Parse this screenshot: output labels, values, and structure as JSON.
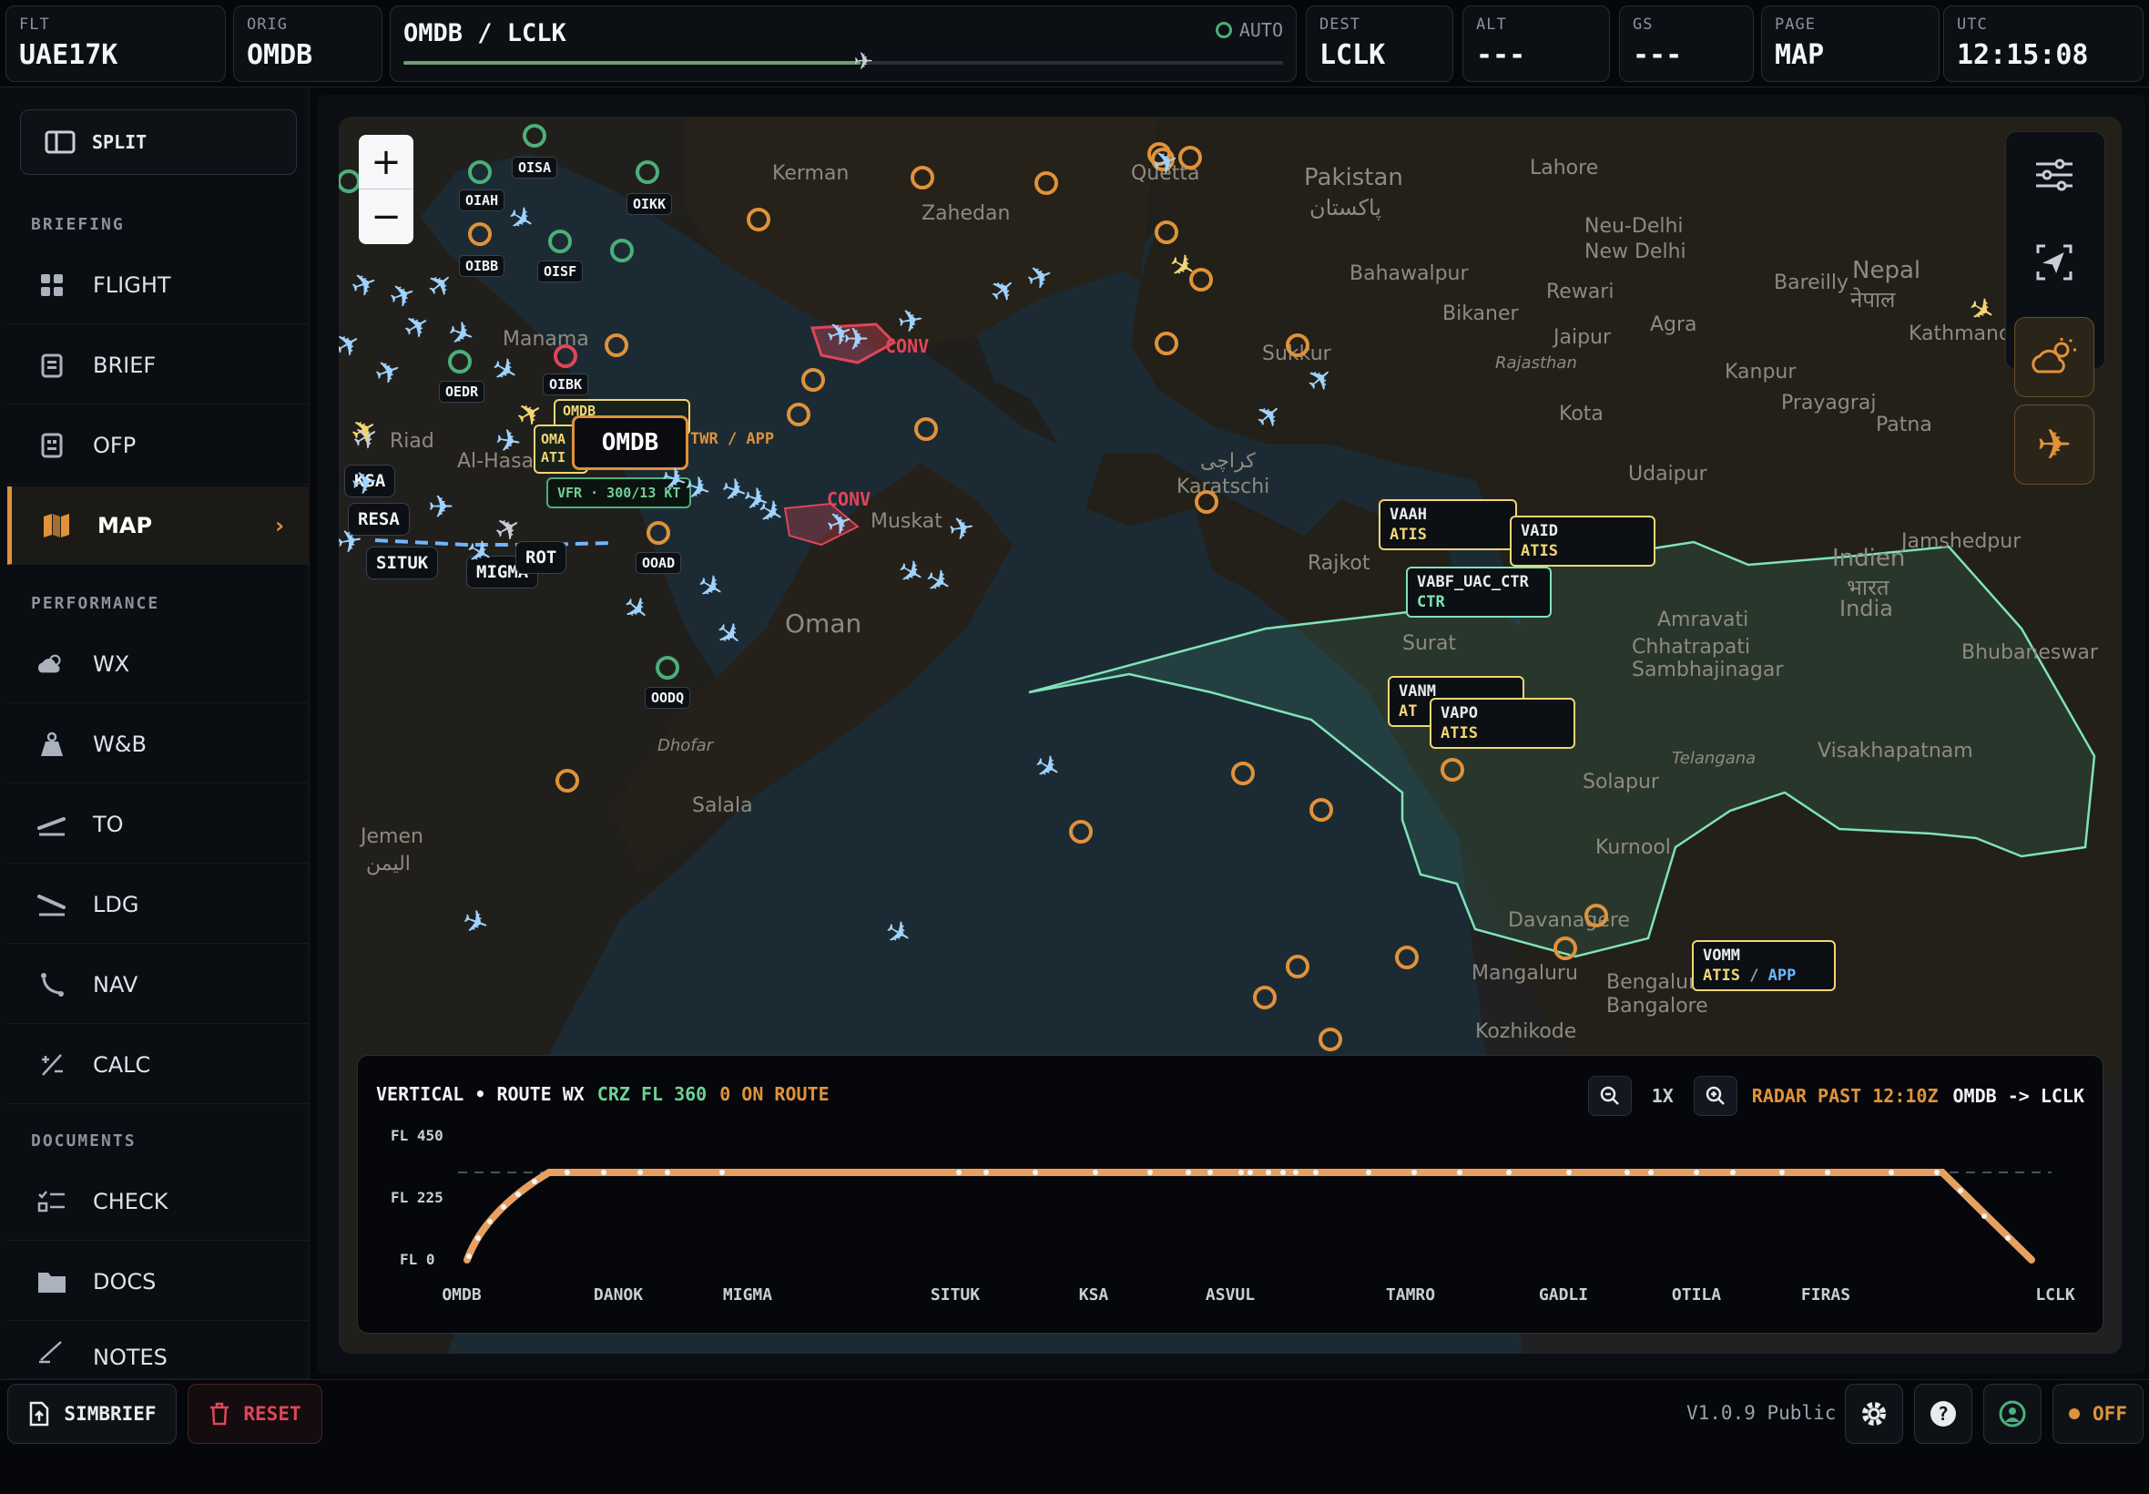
{
  "topbar": {
    "flt": {
      "label": "FLT",
      "value": "UAE17K"
    },
    "orig": {
      "label": "ORIG",
      "value": "OMDB"
    },
    "route": {
      "value": "OMDB / LCLK",
      "auto": "AUTO",
      "progress": 0.52
    },
    "dest": {
      "label": "DEST",
      "value": "LCLK"
    },
    "alt": {
      "label": "ALT",
      "value": "---"
    },
    "gs": {
      "label": "GS",
      "value": "---"
    },
    "page": {
      "label": "PAGE",
      "value": "MAP"
    },
    "utc": {
      "label": "UTC",
      "value": "12:15:08"
    }
  },
  "sidebar": {
    "split_label": "SPLIT",
    "sections": {
      "briefing": "BRIEFING",
      "performance": "PERFORMANCE",
      "documents": "DOCUMENTS"
    },
    "items": [
      {
        "label": "FLIGHT",
        "icon": "grid-icon"
      },
      {
        "label": "BRIEF",
        "icon": "clipboard-icon"
      },
      {
        "label": "OFP",
        "icon": "document-icon"
      },
      {
        "label": "MAP",
        "icon": "map-icon",
        "active": true
      },
      {
        "label": "WX",
        "icon": "cloud-sun-icon"
      },
      {
        "label": "W&B",
        "icon": "weight-icon"
      },
      {
        "label": "TO",
        "icon": "takeoff-icon"
      },
      {
        "label": "LDG",
        "icon": "landing-icon"
      },
      {
        "label": "NAV",
        "icon": "route-icon"
      },
      {
        "label": "CALC",
        "icon": "calc-icon"
      },
      {
        "label": "CHECK",
        "icon": "checklist-icon"
      },
      {
        "label": "DOCS",
        "icon": "folder-icon"
      },
      {
        "label": "NOTES",
        "icon": "pen-icon"
      }
    ]
  },
  "bottombar": {
    "simbrief": "SIMBRIEF",
    "reset": "RESET",
    "version": "V1.0.9 Public",
    "off": "OFF"
  },
  "map": {
    "zoom_in": "+",
    "zoom_out": "−",
    "labels": {
      "place_names": [
        "Pakistan",
        "پاکستان",
        "Lahore",
        "Neu-Delhi",
        "New Delhi",
        "Bareilly",
        "Nepal",
        "नेपाल",
        "Bikaner",
        "Rajasthan",
        "Jaipur",
        "Agra",
        "Kanpur",
        "Prayagraj",
        "Patna",
        "Kota",
        "Udaipur",
        "Indien",
        "भारत",
        "India",
        "Rajkot",
        "Surat",
        "Amravati",
        "Chhatrapati Sambhajinagar",
        "Jamshedpur",
        "Bhubaneswar",
        "Visakhapatnam",
        "Telangana",
        "Solapur",
        "Kurnool",
        "Davanagere",
        "Bengaluru",
        "Bangalore",
        "Mangaluru",
        "Kozhikode",
        "Karatschi",
        "کراچی",
        "Sukkur",
        "Zahedan",
        "Kerman",
        "Quetta",
        "Muskat",
        "Salala",
        "Jemen",
        "اليمن",
        "Dhofar",
        "Al-Hasa",
        "Riad",
        "Manama",
        "Oman",
        "Kathmandu",
        "Bahawalpur",
        "Rewari"
      ],
      "conv1": "CONV",
      "conv2": "CONV"
    },
    "airports_green": [
      "OISA",
      "OIAH",
      "OIKK",
      "OISF",
      "OEDR",
      "OODQ"
    ],
    "airports_other": [
      "OIBB",
      "OIBK",
      "OOAD"
    ],
    "waypoints": [
      "SITUK",
      "MIGMA",
      "RESA",
      "KSA",
      "ROT"
    ],
    "omdb_popup": {
      "code": "OMDB",
      "sub": "OMDB",
      "stations": "TWR / APP",
      "vfr": "VFR · 300/13 KT",
      "atis": "OMA ATI"
    },
    "atc": [
      {
        "code": "VAAH",
        "svc": "ATIS"
      },
      {
        "code": "VAID",
        "svc": "ATIS"
      },
      {
        "code": "VABF_UAC_CTR",
        "svc": "CTR"
      },
      {
        "code": "VANM",
        "svc": "AT"
      },
      {
        "code": "VAPO",
        "svc": "ATIS"
      },
      {
        "code": "VOMM",
        "svc": "ATIS",
        "svc2": "APP"
      }
    ]
  },
  "profile": {
    "title": "VERTICAL • ROUTE WX",
    "crz": "CRZ FL 360",
    "onroute": "0 ON ROUTE",
    "zoom": "1X",
    "radar": "RADAR PAST 12:10Z",
    "pair": "OMDB -> LCLK",
    "levels": [
      "FL 450",
      "FL 225",
      "FL 0"
    ],
    "waypoints": [
      "OMDB",
      "DANOK",
      "MIGMA",
      "SITUK",
      "KSA",
      "ASVUL",
      "TAMRO",
      "GADLI",
      "OTILA",
      "FIRAS",
      "LCLK"
    ]
  },
  "colors": {
    "accent": "#e0923a",
    "green": "#4caf7a",
    "atc_yellow": "#f2d675",
    "airtraffic": "#9fd3ff",
    "sector": "#7fe3b8",
    "conv": "#e0455a"
  }
}
